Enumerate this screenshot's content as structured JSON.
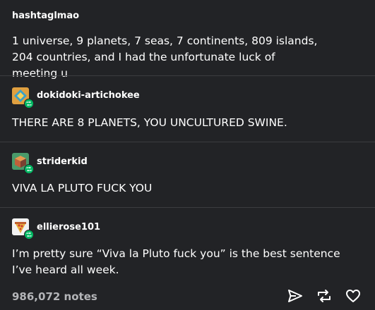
{
  "posts": [
    {
      "username": "hashtaglmao",
      "avatar": null,
      "text": "1 universe, 9 planets, 7 seas, 7 continents, 809 islands, 204 countries, and I had the unfortunate luck of meeting u"
    },
    {
      "username": "dokidoki-artichokee",
      "avatar": "diamond-avatar-icon",
      "text": "THERE ARE 8 PLANETS, YOU UNCULTURED SWINE."
    },
    {
      "username": "striderkid",
      "avatar": "cube-avatar-icon",
      "text": "VIVA LA PLUTO FUCK YOU"
    },
    {
      "username": "ellierose101",
      "avatar": "pizza-avatar-icon",
      "text": "I’m pretty sure “Viva la Pluto fuck you” is the best sentence I’ve heard all week."
    }
  ],
  "footer": {
    "notes": "986,072 notes",
    "actions": [
      "share-icon",
      "reblog-icon",
      "like-icon"
    ]
  },
  "colors": {
    "background": "#222326",
    "divider": "#3c3d40",
    "reblog_badge": "#00b862",
    "notes_text": "#b4b5b8"
  }
}
